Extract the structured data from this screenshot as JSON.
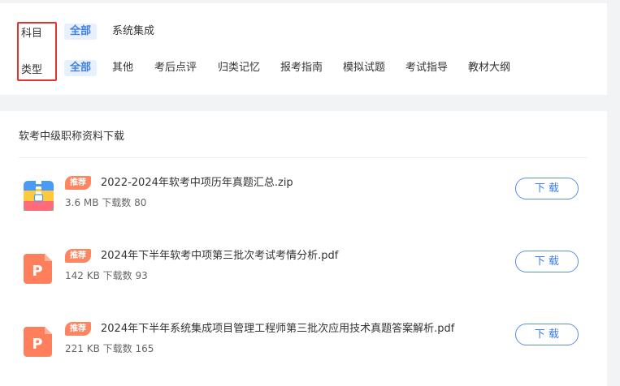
{
  "filters": {
    "subject_label": "科目",
    "type_label": "类型",
    "subjects": [
      "全部",
      "系统集成"
    ],
    "types": [
      "全部",
      "其他",
      "考后点评",
      "归类记忆",
      "报考指南",
      "模拟试题",
      "考试指导",
      "教材大纲"
    ]
  },
  "list": {
    "title": "软考中级职称资料下载",
    "files": [
      {
        "badge": "推荐",
        "name": "2022-2024年软考中项历年真题汇总.zip",
        "meta": "3.6 MB 下载数 80",
        "button": "下 载",
        "icon": "zip-file-icon"
      },
      {
        "badge": "推荐",
        "name": "2024年下半年软考中项第三批次考试考情分析.pdf",
        "meta": "142 KB 下载数 93",
        "button": "下 载",
        "icon": "pdf-file-icon"
      },
      {
        "badge": "推荐",
        "name": "2024年下半年系统集成项目管理工程师第三批次应用技术真题答案解析.pdf",
        "meta": "221 KB 下载数 165",
        "button": "下 载",
        "icon": "pdf-file-icon"
      }
    ]
  },
  "colors": {
    "accent": "#3d7fe6",
    "badge": "#ff8560",
    "pdf": "#ff7f5c",
    "highlight_box": "#e5322d"
  }
}
